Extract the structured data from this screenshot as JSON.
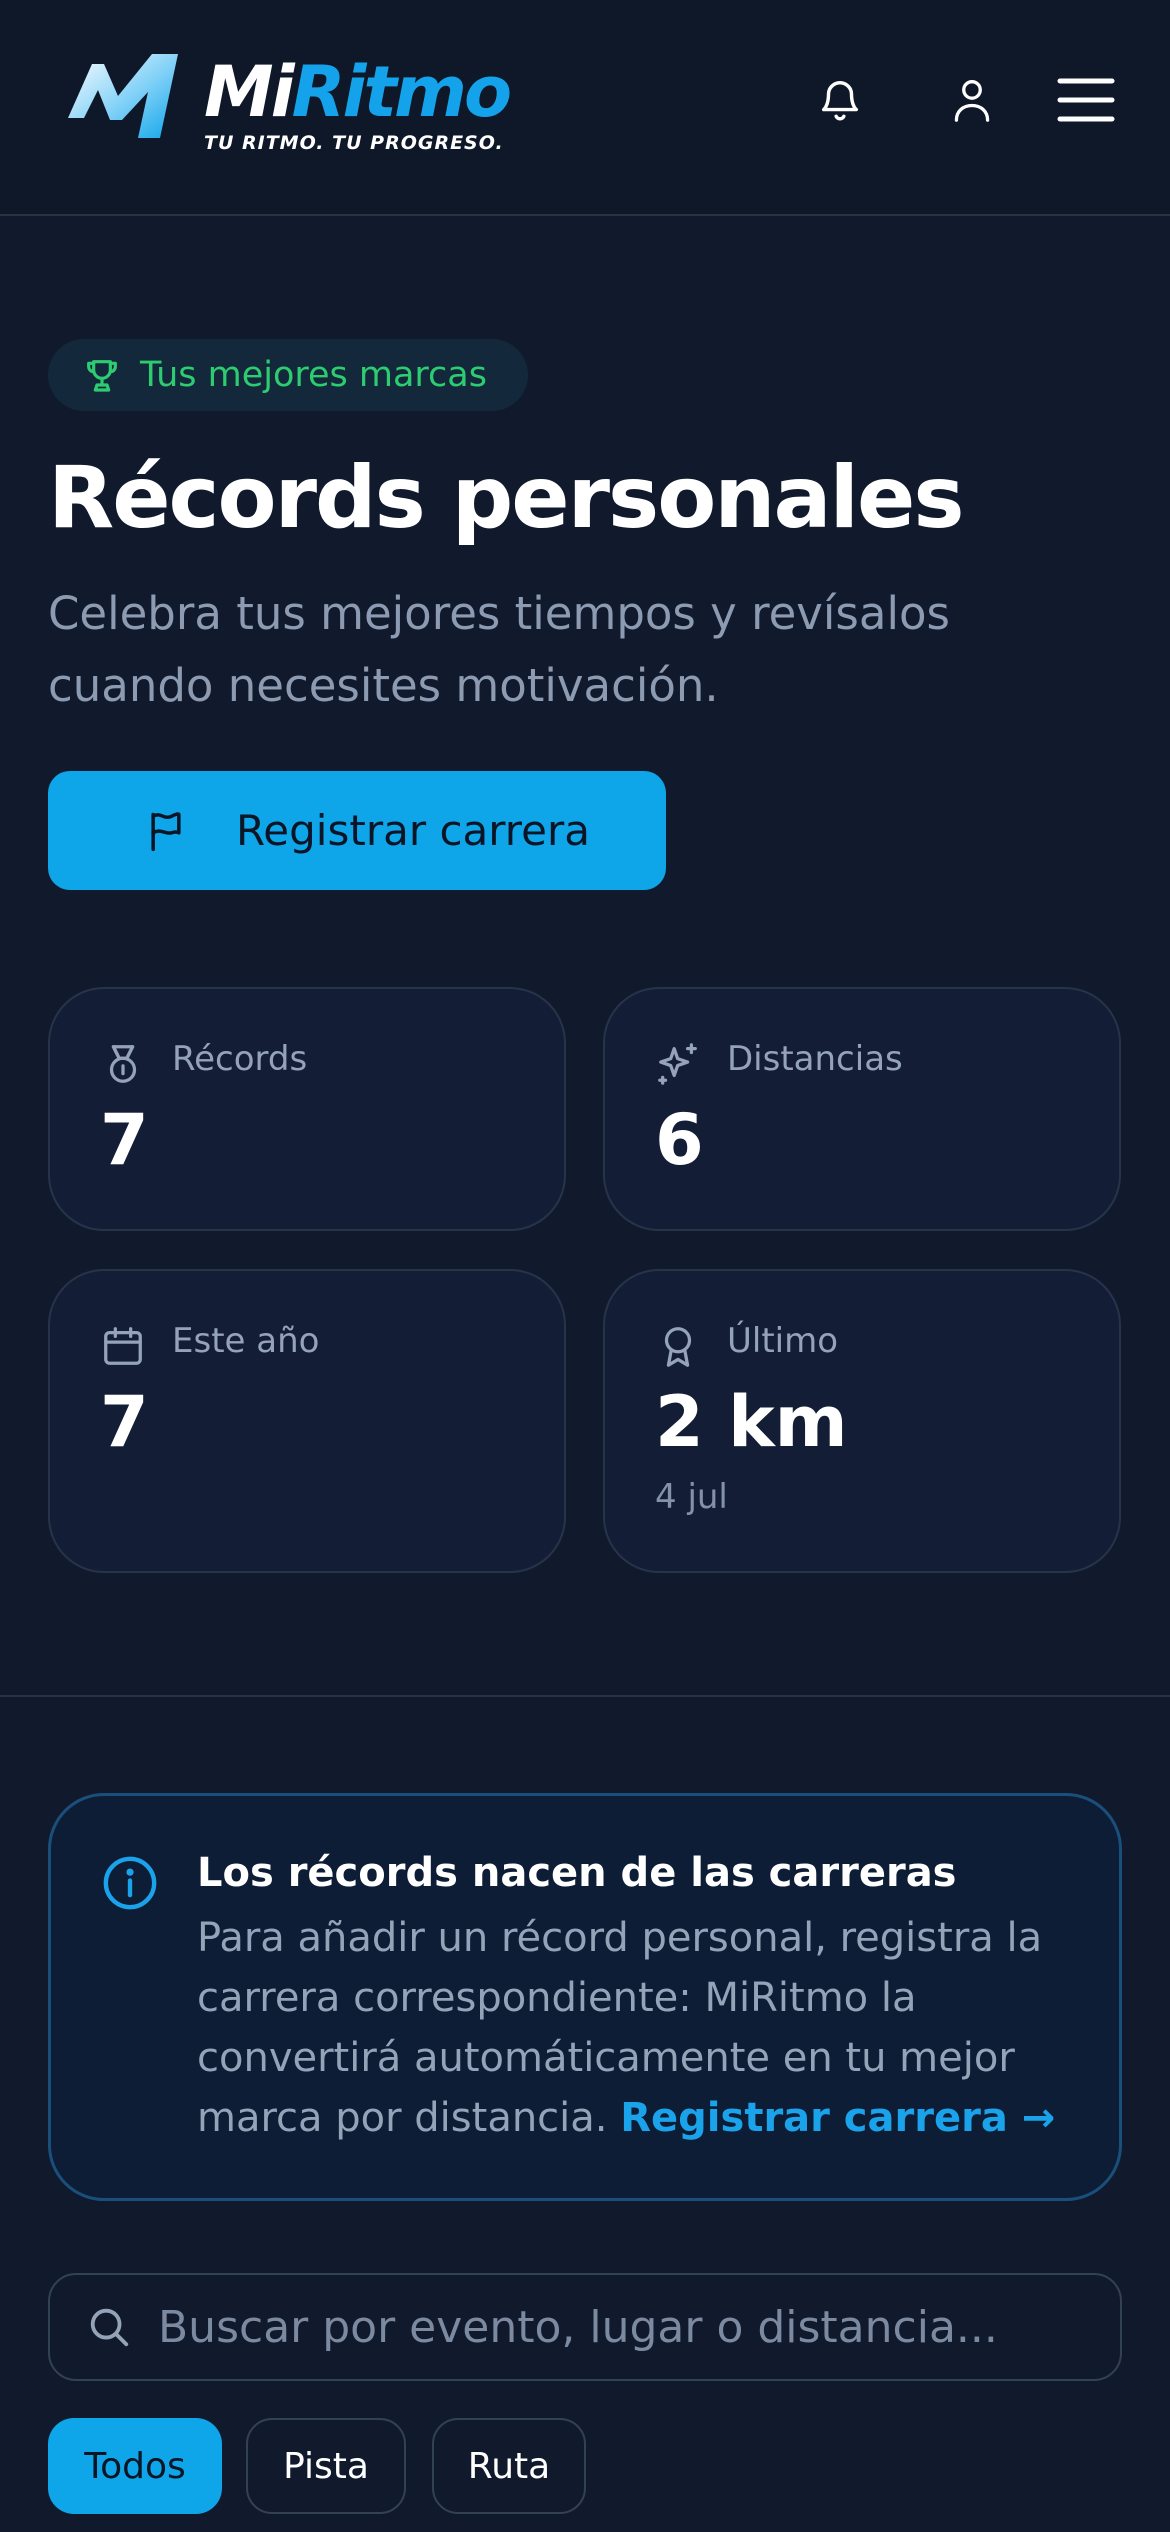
{
  "header": {
    "brand_first": "Mi",
    "brand_second": "Ritmo",
    "tagline": "TU RITMO. TU PROGRESO.",
    "icons": [
      "logo-mark",
      "bell-icon",
      "user-icon",
      "menu-icon"
    ]
  },
  "hero": {
    "badge": "Tus mejores marcas",
    "title": "Récords personales",
    "subtitle": "Celebra tus mejores tiempos y revísalos cuando necesites motivación.",
    "cta_label": "Registrar carrera"
  },
  "stats": [
    {
      "label": "Récords",
      "value": "7",
      "icon": "medal-icon"
    },
    {
      "label": "Distancias",
      "value": "6",
      "icon": "sparkles-icon"
    },
    {
      "label": "Este año",
      "value": "7",
      "icon": "calendar-icon"
    },
    {
      "label": "Último",
      "value": "2 km",
      "sub": "4 jul",
      "icon": "award-icon"
    }
  ],
  "info": {
    "title": "Los récords nacen de las carreras",
    "body": "Para añadir un récord personal, registra la carrera correspondiente: MiRitmo la convertirá automáticamente en tu mejor marca por distancia. ",
    "link": "Registrar carrera →"
  },
  "search": {
    "placeholder": "Buscar por evento, lugar o distancia..."
  },
  "filters": [
    {
      "label": "Todos",
      "active": true
    },
    {
      "label": "Pista",
      "active": false
    },
    {
      "label": "Ruta",
      "active": false
    }
  ],
  "colors": {
    "background": "#111a2d",
    "accent": "#0ea5e9",
    "badge_green": "#2ecc71",
    "card": "#131e36"
  }
}
